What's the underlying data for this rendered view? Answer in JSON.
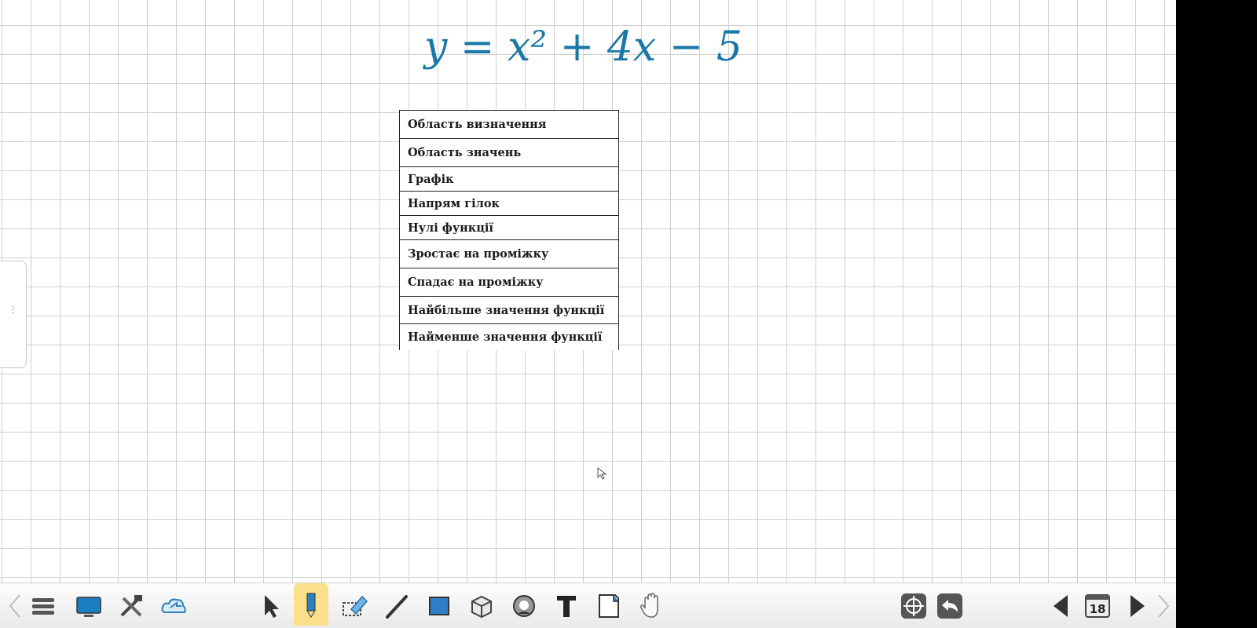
{
  "board": {
    "formula_text": "y = x² + 4x − 5"
  },
  "table": {
    "rows": [
      "Область визначення",
      "Область значень",
      "Графік",
      "Напрям гілок",
      "Нулі функції",
      "Зростає на проміжку",
      "Спадає на проміжку",
      "Найбільше значення функції",
      "Найменше значення функції"
    ]
  },
  "side_panel": {
    "handle_glyph": "⋮"
  },
  "toolbar": {
    "page_number": "18",
    "icons": [
      "chevron-left-icon",
      "menu-icon",
      "display-icon",
      "tools-icon",
      "cloud-icon",
      "select-arrow-icon",
      "pencil-icon",
      "eraser-icon",
      "line-icon",
      "rectangle-icon",
      "cube-icon",
      "fill-icon",
      "text-icon",
      "page-corner-icon",
      "hand-icon",
      "target-icon",
      "undo-icon",
      "previous-page-icon",
      "page-icon",
      "next-page-icon",
      "chevron-right-icon"
    ]
  },
  "colors": {
    "ink": "#1a78a8",
    "grid": "#cfcfcf",
    "pencil_highlight": "#fbe08a"
  }
}
